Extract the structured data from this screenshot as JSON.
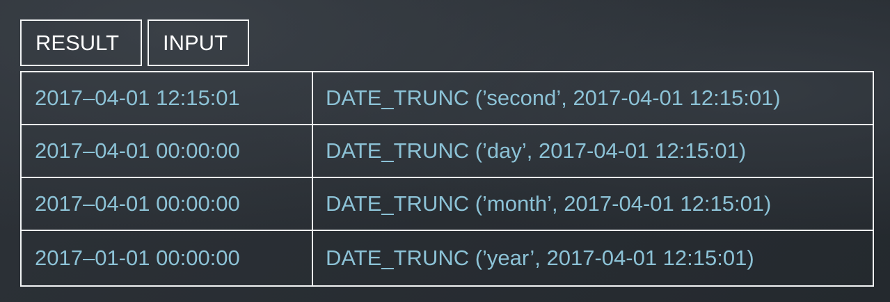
{
  "header": {
    "result_label": "RESULT",
    "input_label": "INPUT"
  },
  "rows": [
    {
      "result": "2017–04-01 12:15:01",
      "input": "DATE_TRUNC (’second’, 2017-04-01 12:15:01)"
    },
    {
      "result": "2017–04-01 00:00:00",
      "input": "DATE_TRUNC (’day’, 2017-04-01 12:15:01)"
    },
    {
      "result": "2017–04-01 00:00:00",
      "input": "DATE_TRUNC (’month’, 2017-04-01 12:15:01)"
    },
    {
      "result": "2017–01-01 00:00:00",
      "input": "DATE_TRUNC (’year’, 2017-04-01 12:15:01)"
    }
  ],
  "colors": {
    "background": "#2a2f35",
    "border": "#f2f4f5",
    "header_text": "#ffffff",
    "cell_text": "#8cc2d6"
  }
}
